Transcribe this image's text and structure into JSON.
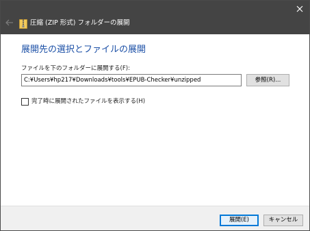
{
  "window": {
    "title": "圧縮 (ZIP 形式) フォルダーの展開",
    "back_icon": "back-arrow-icon",
    "folder_icon": "zip-folder-icon",
    "close_icon": "close-icon"
  },
  "main": {
    "heading": "展開先の選択とファイルの展開",
    "path_label": "ファイルを下のフォルダーに展開する(F):",
    "path_value": "C:¥Users¥hp217¥Downloads¥tools¥EPUB-Checker¥unzipped",
    "browse_label": "参照(R)...",
    "show_files_label": "完了時に展開されたファイルを表示する(H)",
    "show_files_checked": false
  },
  "footer": {
    "extract_label": "展開(E)",
    "cancel_label": "キャンセル"
  },
  "colors": {
    "titlebar": "#444444",
    "heading": "#1b4fa6",
    "accent": "#0078d7",
    "footer": "#f0f0f0"
  }
}
